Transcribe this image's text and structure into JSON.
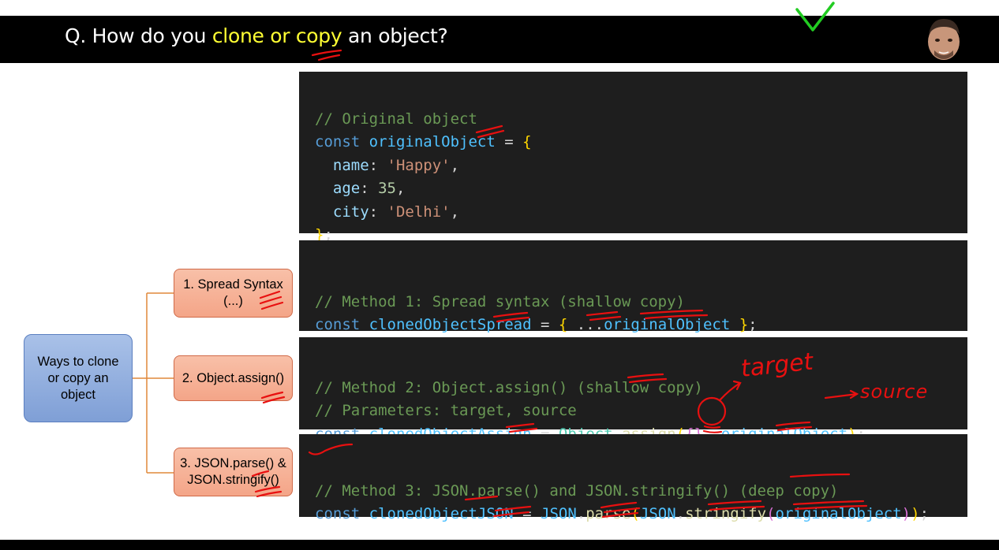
{
  "header": {
    "title_prefix": "Q. How do you ",
    "title_highlight": "clone or copy",
    "title_suffix": " an object?",
    "avatar_icon": "presenter-avatar-icon",
    "checkmark_icon": "green-checkmark-icon",
    "highlight_color": "#ffff33"
  },
  "diagram": {
    "root": "Ways to clone\nor copy an\nobject",
    "nodes": [
      "1. Spread Syntax\n(...)",
      "2. Object.assign()",
      "3. JSON.parse() &\nJSON.stringify()"
    ]
  },
  "code_blocks": [
    {
      "lines": [
        "// Original object",
        "const originalObject = {",
        "name: 'Happy',",
        "age: 35,",
        "city: 'Delhi',",
        "};"
      ]
    },
    {
      "lines": [
        "// Method 1: Spread syntax (shallow copy)",
        "const clonedObjectSpread = { ...originalObject };"
      ]
    },
    {
      "lines": [
        "// Method 2: Object.assign() (shallow copy)",
        "// Parameters: target, source",
        "const clonedObjectAssign = Object.assign({}, originalObject);"
      ]
    },
    {
      "lines": [
        "// Method 3: JSON.parse() and JSON.stringify() (deep copy)",
        "const clonedObjectJSON = JSON.parse(JSON.stringify(originalObject));"
      ]
    }
  ],
  "annotations": {
    "target_label": "target",
    "source_label": "source",
    "ink_color": "#e81010"
  }
}
